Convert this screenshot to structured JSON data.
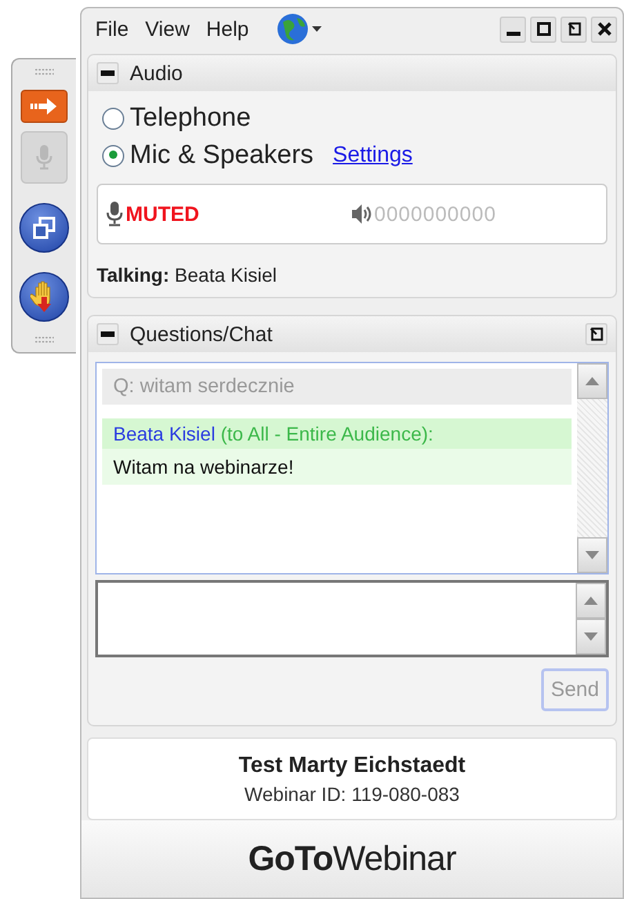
{
  "side_toolbar": [
    {
      "kind": "arrow",
      "disabled": false
    },
    {
      "kind": "mic",
      "disabled": true
    },
    {
      "kind": "windows",
      "disabled": false
    },
    {
      "kind": "hand",
      "disabled": false
    }
  ],
  "menu": [
    "File",
    "View",
    "Help"
  ],
  "audio": {
    "title": "Audio",
    "options": [
      {
        "label": "Telephone",
        "selected": false
      },
      {
        "label": "Mic & Speakers",
        "selected": true
      }
    ],
    "settings_link": "Settings",
    "mic_status": "MUTED",
    "speaker_level": "0000000000",
    "talking": "**Talking:** Beata Kisiel"
  },
  "chat": {
    "title": "Questions/Chat",
    "messages": [
      {
        "kind": "question",
        "text": "Q: witam serdecznie"
      },
      {
        "kind": "message",
        "sender": "Beata Kisiel",
        "recipient": "(to All - Entire Audience):",
        "text": "Witam na webinarze!"
      }
    ],
    "send_button": "Send"
  },
  "footer": {
    "organizer": "Test Marty Eichstaedt",
    "webinar_id": "Webinar ID: 119-080-083",
    "logo": "**GoTo**Webinar"
  }
}
